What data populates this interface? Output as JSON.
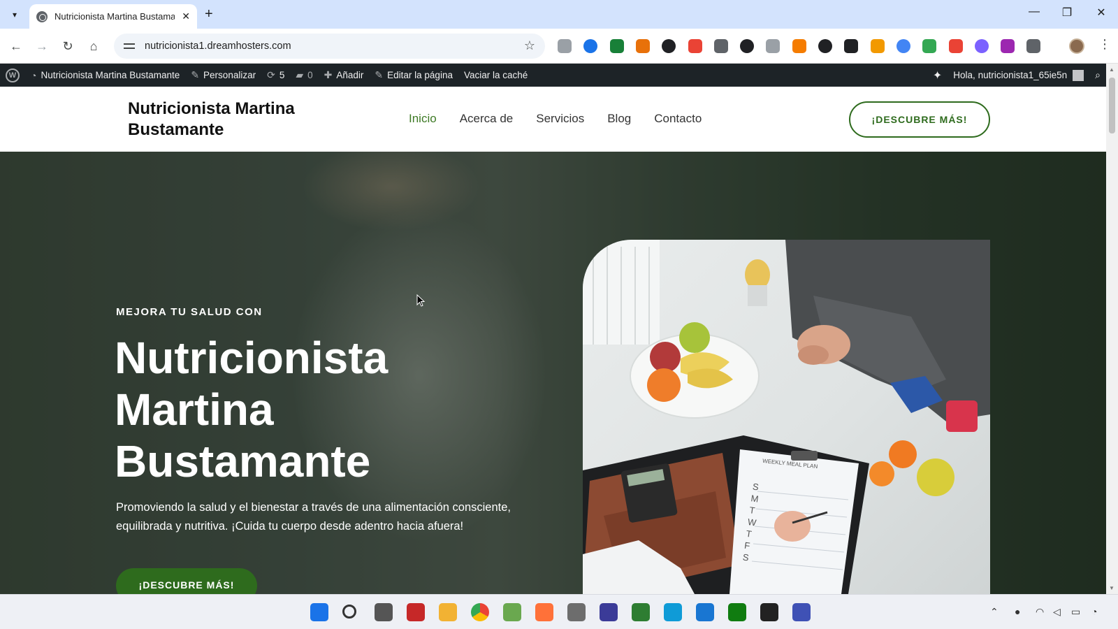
{
  "browser": {
    "tab_title": "Nutricionista Martina Bustamante",
    "url": "nutricionista1.dreamhosters.com",
    "extension_colors": [
      "#9aa0a6",
      "#1a73e8",
      "#188038",
      "#e8710a",
      "#202124",
      "#ea4335",
      "#5f6368",
      "#202124",
      "#9aa0a6",
      "#f57c00",
      "#202124",
      "#202124",
      "#f29900",
      "#4285f4",
      "#34a853",
      "#ea4335",
      "#7b61ff",
      "#9c27b0",
      "#5f6368"
    ]
  },
  "admin_bar": {
    "site_name": "Nutricionista Martina Bustamante",
    "customize": "Personalizar",
    "updates_count": "5",
    "comments_count": "0",
    "add_new": "Añadir",
    "edit_page": "Editar la página",
    "clear_cache": "Vaciar la caché",
    "greeting": "Hola, nutricionista1_65ie5n"
  },
  "site": {
    "title": "Nutricionista Martina Bustamante",
    "menu": [
      "Inicio",
      "Acerca de",
      "Servicios",
      "Blog",
      "Contacto"
    ],
    "active_menu": "Inicio",
    "header_cta": "¡DESCUBRE MÁS!"
  },
  "hero": {
    "eyebrow": "MEJORA TU SALUD CON",
    "title": "Nutricionista Martina Bustamante",
    "description": "Promoviendo la salud y el bienestar a través de una alimentación consciente, equilibrada y nutritiva. ¡Cuida tu cuerpo desde adentro hacia afuera!",
    "cta": "¡DESCUBRE MÁS!",
    "meal_plan_label": "WEEKLY MEAL PLAN",
    "meal_plan_days": "S M T W T F S"
  },
  "colors": {
    "accent_green": "#2e6b1d",
    "active_link": "#3e7a25",
    "admin_bar_bg": "#1d2327"
  }
}
